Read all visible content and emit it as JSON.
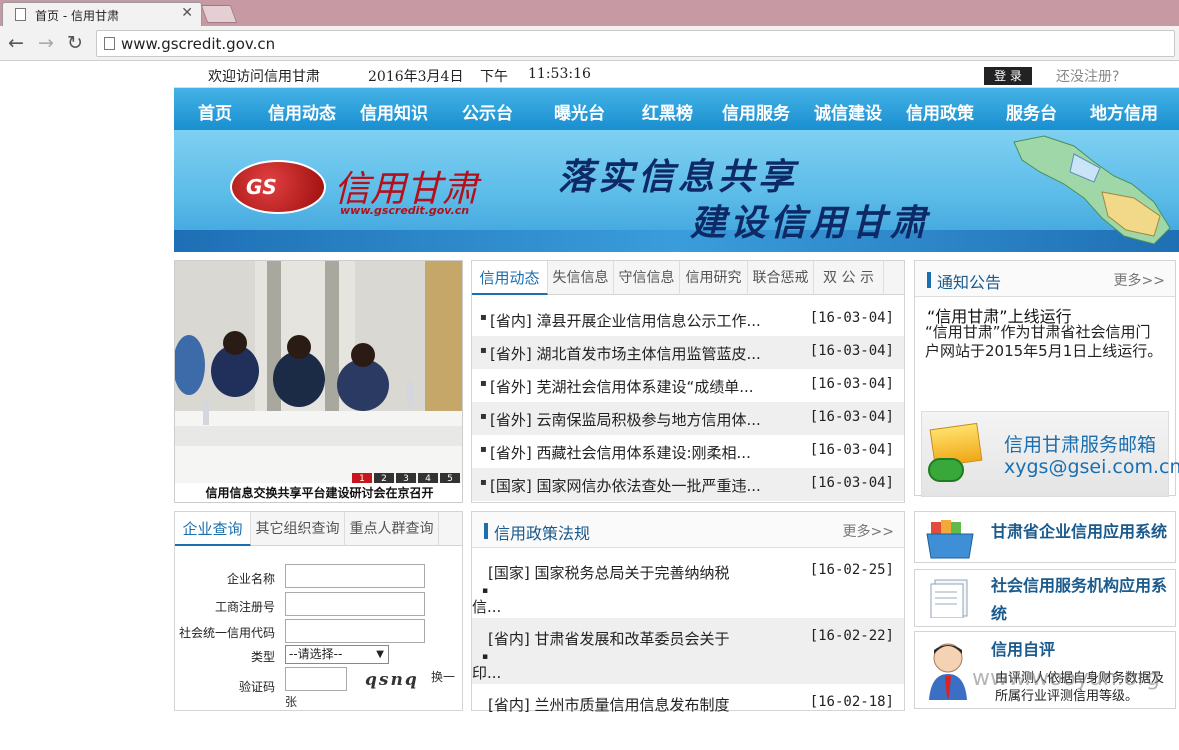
{
  "browser": {
    "tab_title": "首页 - 信用甘肃",
    "url": "www.gscredit.gov.cn"
  },
  "topbar": {
    "welcome": "欢迎访问信用甘肃",
    "date": "2016年3月4日",
    "ampm": "下午",
    "time": "11:53:16",
    "login": "登 录",
    "register": "还没注册?"
  },
  "nav": [
    "首页",
    "信用动态",
    "信用知识",
    "公示台",
    "曝光台",
    "红黑榜",
    "信用服务",
    "诚信建设",
    "信用政策",
    "服务台",
    "地方信用"
  ],
  "banner": {
    "logo_abbr": "GS",
    "logo_name": "信用甘肃",
    "logo_url": "www.gscredit.gov.cn",
    "slogan1": "落实信息共享",
    "slogan2": "建设信用甘肃"
  },
  "photo": {
    "caption": "信用信息交换共享平台建设研讨会在京召开",
    "pages": [
      "1",
      "2",
      "3",
      "4",
      "5"
    ]
  },
  "news": {
    "tabs": [
      "信用动态",
      "失信信息",
      "守信信息",
      "信用研究",
      "联合惩戒",
      "双 公 示"
    ],
    "items": [
      {
        "title": "[省内] 漳县开展企业信用信息公示工作...",
        "date": "[16-03-04]"
      },
      {
        "title": "[省外] 湖北首发市场主体信用监管蓝皮...",
        "date": "[16-03-04]"
      },
      {
        "title": "[省外] 芜湖社会信用体系建设“成绩单...",
        "date": "[16-03-04]"
      },
      {
        "title": "[省外] 云南保监局积极参与地方信用体...",
        "date": "[16-03-04]"
      },
      {
        "title": "[省外] 西藏社会信用体系建设:刚柔相...",
        "date": "[16-03-04]"
      },
      {
        "title": "[国家] 国家网信办依法查处一批严重违...",
        "date": "[16-03-04]"
      }
    ]
  },
  "notice": {
    "title": "通知公告",
    "more": "更多>>",
    "item_title": "“信用甘肃”上线运行",
    "item_body": "“信用甘肃”作为甘肃省社会信用门户网站于2015年5月1日上线运行。",
    "mail_line1": "信用甘肃服务邮箱",
    "mail_line2": "xygs@gsei.com.cn"
  },
  "query": {
    "tabs": [
      "企业查询",
      "其它组织查询",
      "重点人群查询"
    ],
    "labels": [
      "企业名称",
      "工商注册号",
      "社会统一信用代码",
      "类型",
      "验证码"
    ],
    "type_select": "--请选择--",
    "captcha": "qsnq",
    "swap_a": "换一",
    "swap_b": "张"
  },
  "policy": {
    "title": "信用政策法规",
    "more": "更多>>",
    "items": [
      {
        "title": "[国家]  国家税务总局关于完善纳纳税",
        "cont": "信...",
        "date": "[16-02-25]"
      },
      {
        "title": "[省内]  甘肃省发展和改革委员会关于",
        "cont": "印...",
        "date": "[16-02-22]"
      },
      {
        "title": "[省内]  兰州市质量信用信息发布制度",
        "cont": "",
        "date": "[16-02-18]"
      }
    ]
  },
  "systems": {
    "s1": "甘肃省企业信用应用系统",
    "s2a": "社会信用服务机构应用系",
    "s2b": "统",
    "s3_title": "信用自评",
    "s3_desc": "由评测人依据自身财务数据及所属行业评测信用等级。"
  },
  "watermark": "www.wooyun.org"
}
